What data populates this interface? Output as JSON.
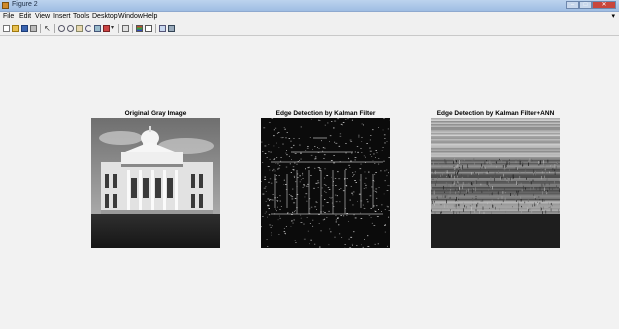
{
  "window": {
    "title": "Figure 2"
  },
  "menu": [
    "File",
    "Edit",
    "View",
    "Insert",
    "Tools",
    "Desktop",
    "Window",
    "Help"
  ],
  "toolbar_icons": [
    "new-figure-icon",
    "open-file-icon",
    "save-icon",
    "print-icon",
    "edit-plot-icon",
    "zoom-in-icon",
    "zoom-out-icon",
    "pan-icon",
    "rotate-icon",
    "data-cursor-icon",
    "brush-icon",
    "link-plot-icon",
    "colorbar-icon",
    "legend-icon",
    "hide-plot-tools-icon",
    "show-plot-tools-icon"
  ],
  "figures": [
    {
      "title": "Original Gray Image",
      "image": "building-photo"
    },
    {
      "title": "Edge Detection by Kalman Filter",
      "image": "edge-map-kalman"
    },
    {
      "title": "Edge Detection by Kalman Filter+ANN",
      "image": "edge-map-kalman-ann"
    }
  ]
}
